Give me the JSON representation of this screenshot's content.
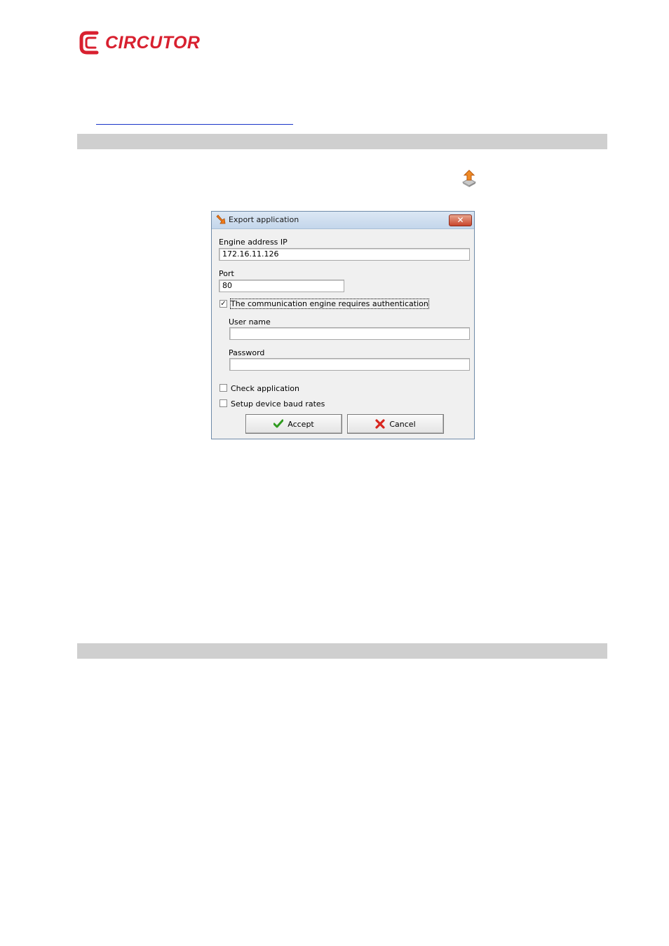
{
  "header": {
    "logo_text": "CIRCUTOR"
  },
  "dialog": {
    "title": "Export application",
    "close_glyph": "✕",
    "engine_ip_label": "Engine address IP",
    "engine_ip_value": "172.16.11.126",
    "port_label": "Port",
    "port_value": "80",
    "auth_checkbox_label": "The communication engine requires authentication",
    "auth_checked": true,
    "auth_check_glyph": "✓",
    "username_label": "User name",
    "username_value": "",
    "password_label": "Password",
    "password_value": "",
    "check_application_label": "Check application",
    "check_application_checked": false,
    "setup_baud_label": "Setup device baud rates",
    "setup_baud_checked": false,
    "accept_label": "Accept",
    "cancel_label": "Cancel"
  },
  "colors": {
    "brand_red": "#d8202f",
    "section_bar": "#cfcfcf",
    "link_line": "#1a35c9"
  },
  "icons": [
    "circutor-logo-icon",
    "export-application-icon",
    "checkmark-icon",
    "red-x-icon",
    "close-icon"
  ]
}
